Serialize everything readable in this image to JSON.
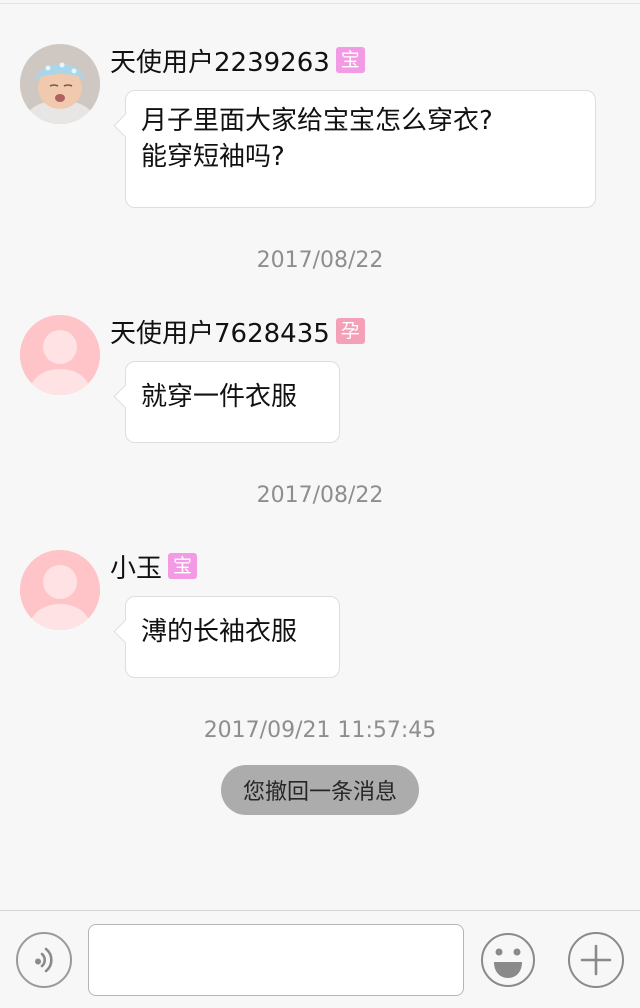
{
  "colors": {
    "tag_bao": "#f29ae3",
    "tag_yun": "#f4a0b6",
    "bubble_border": "#dedede",
    "default_avatar": "#ffc4c8"
  },
  "messages": [
    {
      "user": "天使用户2239263",
      "tag": "宝",
      "avatar": "baby-photo",
      "text_lines": [
        "月子里面大家给宝宝怎么穿衣?",
        "能穿短袖吗?"
      ]
    },
    {
      "timestamp": "2017/08/22",
      "user": "天使用户7628435",
      "tag": "孕",
      "avatar": "default-avatar",
      "text": "就穿一件衣服"
    },
    {
      "timestamp": "2017/08/22",
      "user": "小玉",
      "tag": "宝",
      "avatar": "default-avatar",
      "text": "溥的长袖衣服"
    }
  ],
  "recall": {
    "timestamp": "2017/09/21 11:57:45",
    "notice": "您撤回一条消息"
  },
  "input_bar": {
    "voice_icon": "voice-icon",
    "text_value": "",
    "emoji_icon": "emoji-icon",
    "plus_icon": "plus-icon"
  }
}
